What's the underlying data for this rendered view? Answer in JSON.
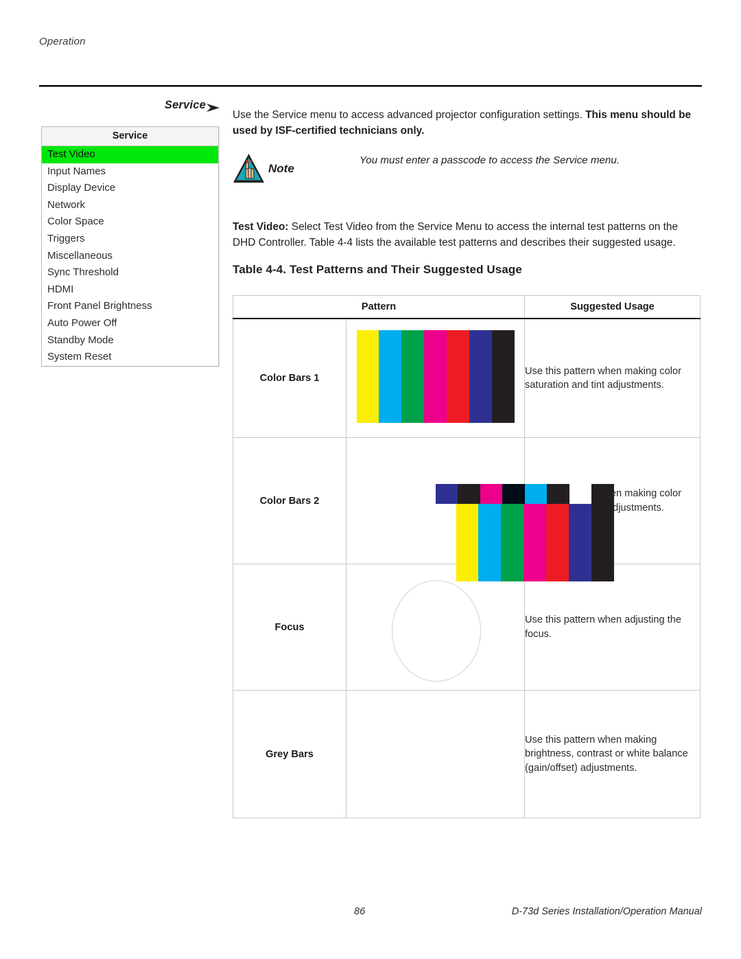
{
  "page": {
    "running_head": "Operation",
    "footer_page_number": "86",
    "footer_manual": "D-73d Series Installation/Operation Manual"
  },
  "side_head": {
    "label": "Service",
    "arrow_icon": "arrow-right-icon"
  },
  "osd_menu": {
    "title": "Service",
    "selected_index": 0,
    "highlight_color": "#00e80a",
    "items": [
      {
        "label": "Test Video"
      },
      {
        "label": "Input Names"
      },
      {
        "label": "Display Device"
      },
      {
        "label": "Network"
      },
      {
        "label": "Color Space"
      },
      {
        "label": "Triggers"
      },
      {
        "label": "Miscellaneous"
      },
      {
        "label": "Sync Threshold"
      },
      {
        "label": "HDMI"
      },
      {
        "label": "Front Panel Brightness"
      },
      {
        "label": "Auto Power Off"
      },
      {
        "label": "Standby Mode"
      },
      {
        "label": "System Reset"
      }
    ]
  },
  "intro": {
    "plain": "Use the Service menu to access advanced projector configuration settings. ",
    "bold": "This menu should be used by ISF-certified technicians only."
  },
  "note": {
    "icon": "note-triangle-hand-icon",
    "label": "Note",
    "text": "You must enter a passcode to access the Service menu."
  },
  "test_video": {
    "lead": "Test Video:",
    "body": " Select Test Video from the Service Menu to access the internal test patterns on the DHD Controller. Table 4-4 lists the available test patterns and describes their suggested usage."
  },
  "table": {
    "caption": "Table 4-4. Test Patterns and Their Suggested Usage",
    "headers": {
      "pattern": "Pattern",
      "usage": "Suggested Usage"
    },
    "rows": [
      {
        "name": "Color Bars 1",
        "usage": "Use this pattern when making color saturation and tint adjustments.",
        "pattern_type": "color-bars-1",
        "bars": [
          "#fcee00",
          "#00aeef",
          "#00a14b",
          "#ec008c",
          "#ed1c24",
          "#2e3192",
          "#231f20"
        ]
      },
      {
        "name": "Color Bars 2",
        "usage": "Use this pattern when making color saturation and tint adjustments.",
        "pattern_type": "color-bars-2",
        "bars_top": [
          "#fcee00",
          "#00aeef",
          "#00a14b",
          "#ec008c",
          "#ed1c24",
          "#2e3192",
          "#231f20"
        ],
        "bars_bottom": [
          "#2e3192",
          "#231f20",
          "#ec008c",
          "#000c18",
          "#00aeef",
          "#231f20",
          "#ffffff",
          "#231f20"
        ]
      },
      {
        "name": "Focus",
        "usage": "Use this pattern when adjusting the focus.",
        "pattern_type": "focus-grid",
        "grid_color": "#dcdcde",
        "background_color": "#5c5c5e"
      },
      {
        "name": "Grey Bars",
        "usage": "Use this pattern when making brightness, contrast or white balance (gain/offset) adjustments.",
        "pattern_type": "grey-bars",
        "steps": 24,
        "top_band": "dark-to-light",
        "bottom_band": "light-to-dark"
      }
    ]
  }
}
